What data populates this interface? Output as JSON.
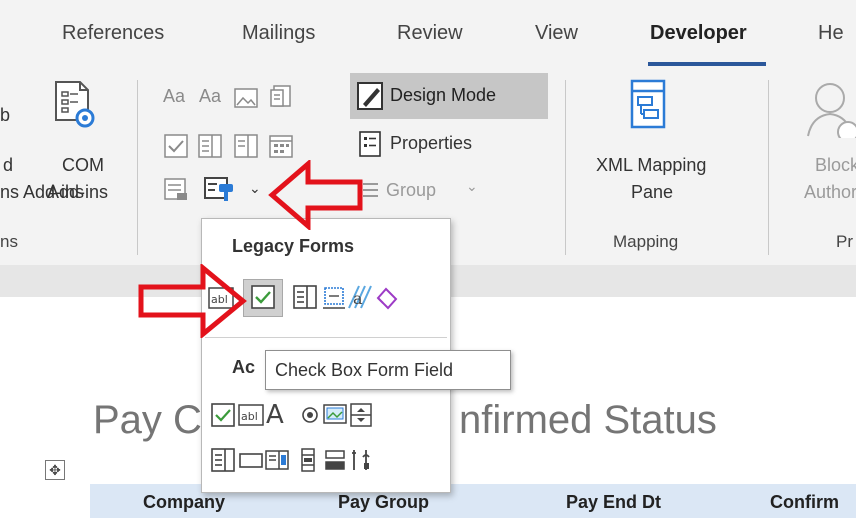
{
  "ribbon": {
    "tabs": [
      {
        "label": "References"
      },
      {
        "label": "Mailings"
      },
      {
        "label": "Review"
      },
      {
        "label": "View"
      },
      {
        "label": "Developer"
      },
      {
        "label": "He"
      }
    ],
    "groups": {
      "addins": {
        "label": "ns",
        "left_text_1": "d",
        "left_text_2": "ns Add-ins",
        "com_line1": "COM",
        "com_line2": "Add-ins"
      },
      "controls": {
        "design_mode": "Design Mode",
        "properties": "Properties",
        "group": "Group"
      },
      "mapping": {
        "label": "Mapping",
        "xml_line1": "XML Mapping",
        "xml_line2": "Pane"
      },
      "protect": {
        "label": "Pr",
        "block_line1": "Block",
        "block_line2": "Authors"
      }
    }
  },
  "dropdown": {
    "legacy_title": "Legacy Forms",
    "activex_title": "Ac",
    "tooltip": "Check Box Form Field",
    "legacy_icons": [
      "text-form-field-icon",
      "check-box-form-field-icon",
      "drop-down-form-field-icon",
      "insert-frame-icon",
      "form-field-shading-icon",
      "reset-form-fields-icon"
    ],
    "activex_icons_row1": [
      "check-box-icon",
      "text-box-icon",
      "label-icon",
      "option-button-icon",
      "image-icon",
      "spin-button-icon"
    ],
    "activex_icons_row2": [
      "list-box-icon",
      "command-button-icon",
      "combo-box-icon",
      "scroll-bar-icon",
      "toggle-button-icon",
      "more-controls-icon"
    ]
  },
  "document": {
    "title": "Pay C",
    "title_right": "nfirmed Status",
    "columns": [
      "Company",
      "Pay Group",
      "Pay End Dt",
      "Confirm"
    ]
  },
  "colors": {
    "accent": "#2b579a",
    "arrow": "#e3121b",
    "table_header": "#dbe7f5"
  }
}
